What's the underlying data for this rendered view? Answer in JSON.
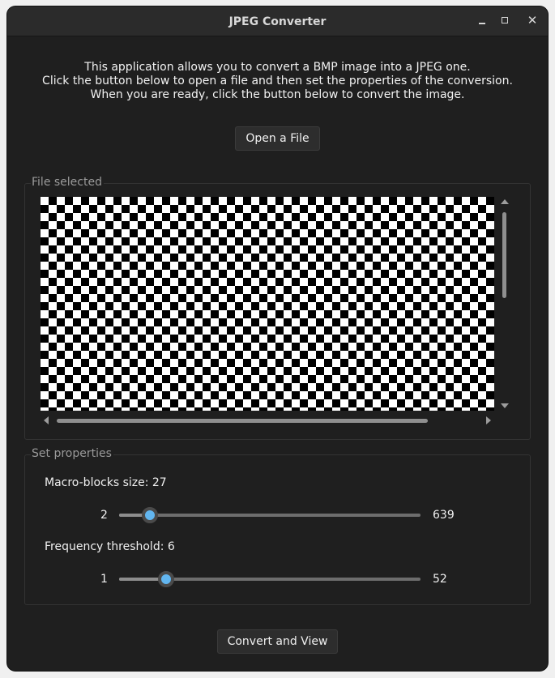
{
  "window": {
    "title": "JPEG Converter"
  },
  "description": {
    "line1": "This application allows you to convert a BMP image into a JPEG one.",
    "line2": "Click the button below to open a file and then set the properties of the conversion.",
    "line3": "When you are ready, click the button below to convert the image."
  },
  "open_button_label": "Open a File",
  "file_group": {
    "title": "File selected",
    "preview": "checkerboard"
  },
  "properties_group": {
    "title": "Set properties",
    "macro_blocks": {
      "label": "Macro-blocks size: 27",
      "min": "2",
      "max": "639",
      "value": 27
    },
    "frequency": {
      "label": "Frequency threshold: 6",
      "min": "1",
      "max": "52",
      "value": 6
    }
  },
  "convert_button_label": "Convert and View",
  "colors": {
    "window_bg": "#1f1f1f",
    "accent": "#62b6f0"
  },
  "icons": {
    "minimize": "minimize-icon",
    "maximize": "maximize-icon",
    "close": "close-icon"
  }
}
